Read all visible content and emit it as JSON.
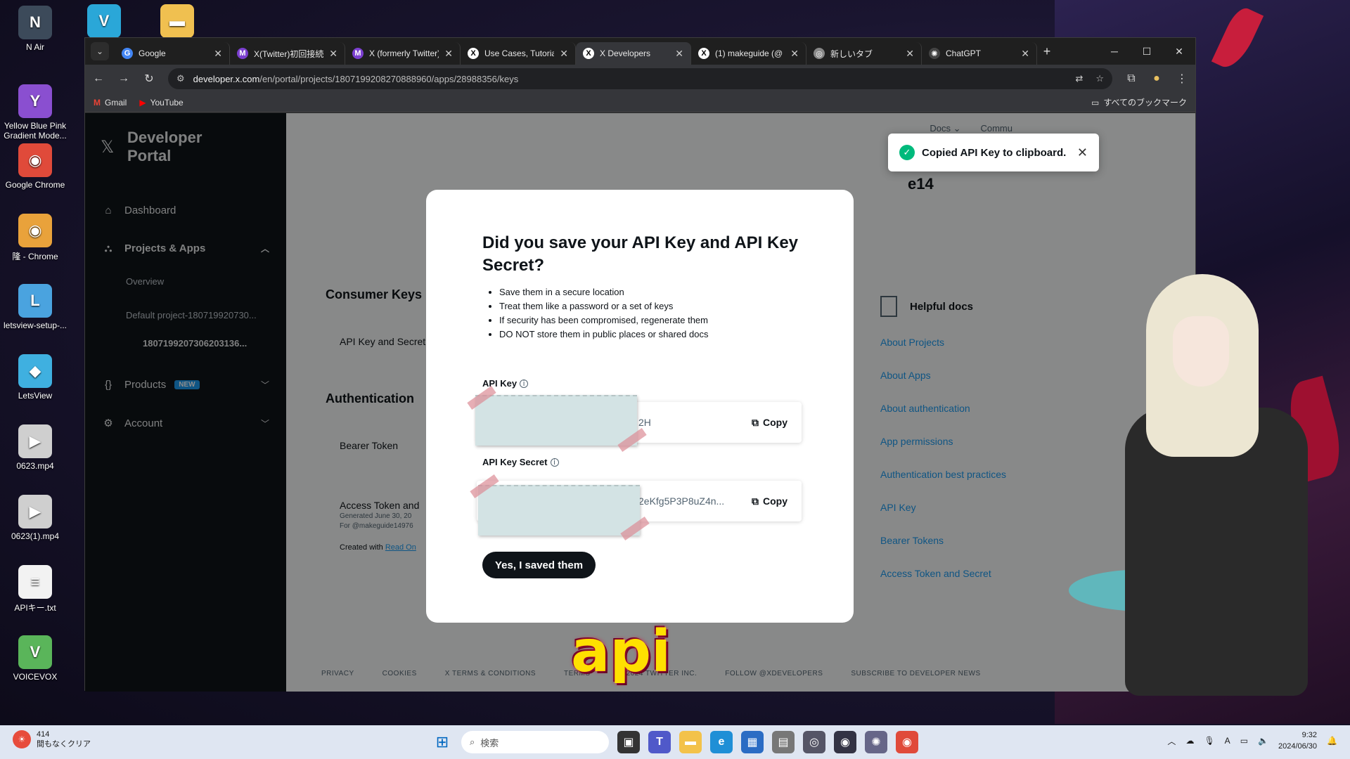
{
  "desktop": {
    "icons": [
      {
        "label": "N Air",
        "glyph": "N",
        "color": "#3c4a5a"
      },
      {
        "label": "Yellow Blue Pink Gradient Mode...",
        "glyph": "Y",
        "color": "#8a4fd0"
      },
      {
        "label": "Google Chrome",
        "glyph": "◉",
        "color": "#e04a3a"
      },
      {
        "label": "隆 - Chrome",
        "glyph": "◉",
        "color": "#e9a23b"
      },
      {
        "label": "letsview-setup-...",
        "glyph": "L",
        "color": "#4aa3df"
      },
      {
        "label": "LetsView",
        "glyph": "◆",
        "color": "#3fb0e0"
      },
      {
        "label": "0623.mp4",
        "glyph": "▶",
        "color": "#cfcfcf"
      },
      {
        "label": "0623(1).mp4",
        "glyph": "▶",
        "color": "#cfcfcf"
      },
      {
        "label": "APIキー.txt",
        "glyph": "≡",
        "color": "#f2f2f2"
      },
      {
        "label": "VOICEVOX",
        "glyph": "V",
        "color": "#5ab55a"
      }
    ],
    "top_icons": [
      {
        "label": "",
        "glyph": "V",
        "color": "#2aa7d8"
      },
      {
        "label": "",
        "glyph": "▬",
        "color": "#f0c050"
      }
    ]
  },
  "browser": {
    "tabs": [
      {
        "title": "Google",
        "favicon": "G",
        "fav_color": "#4285f4"
      },
      {
        "title": "X(Twitter)初回接続",
        "favicon": "M",
        "fav_color": "#7b3fd0"
      },
      {
        "title": "X (formerly Twitter)",
        "favicon": "M",
        "fav_color": "#7b3fd0"
      },
      {
        "title": "Use Cases, Tutorials",
        "favicon": "X",
        "fav_color": "#000000"
      },
      {
        "title": "X Developers",
        "favicon": "X",
        "fav_color": "#000000",
        "active": true
      },
      {
        "title": "(1) makeguide (@",
        "favicon": "X",
        "fav_color": "#000000"
      },
      {
        "title": "新しいタブ",
        "favicon": "◎",
        "fav_color": "#888888"
      },
      {
        "title": "ChatGPT",
        "favicon": "✺",
        "fav_color": "#444444"
      }
    ],
    "url_host": "developer.x.com",
    "url_path": "/en/portal/projects/1807199208270888960/apps/28988356/keys",
    "bookmarks": [
      {
        "label": "Gmail",
        "glyph": "M"
      },
      {
        "label": "YouTube",
        "glyph": "▶"
      }
    ],
    "all_bookmarks": "すべてのブックマーク"
  },
  "portal": {
    "title_line1": "Developer",
    "title_line2": "Portal",
    "nav": {
      "dashboard": "Dashboard",
      "projects_apps": "Projects & Apps",
      "overview": "Overview",
      "default_project": "Default project-180719920730...",
      "app_id": "1807199207306203136...",
      "products": "Products",
      "products_badge": "NEW",
      "account": "Account"
    },
    "topnav": [
      "Docs",
      "Commu"
    ],
    "app_title_suffix": "e14",
    "consumer_keys": "Consumer Keys",
    "api_key_and_secret": "API Key and Secret",
    "authentication": "Authentication",
    "bearer_token": "Bearer Token",
    "access_token": "Access Token and",
    "generated": "Generated June 30, 20",
    "for_user": "For @makeguide14976",
    "created_with": "Created with",
    "read_only": "Read On",
    "helpful_docs": "Helpful docs",
    "helpful_links": [
      "About Projects",
      "About Apps",
      "About authentication",
      "App permissions",
      "Authentication best practices",
      "API Key",
      "Bearer Tokens",
      "Access Token and Secret"
    ],
    "footer": [
      "PRIVACY",
      "COOKIES",
      "X TERMS & CONDITIONS",
      "TERMS",
      "© 2024 TWITTER INC.",
      "FOLLOW @XDEVELOPERS",
      "SUBSCRIBE TO DEVELOPER NEWS"
    ]
  },
  "toast": {
    "message": "Copied API Key to clipboard."
  },
  "modal": {
    "title": "Did you save your API Key and API Key Secret?",
    "bullets": [
      "Save them in a secure location",
      "Treat them like a password or a set of keys",
      "If security has been compromised, regenerate them",
      "DO NOT store them in public places or shared docs"
    ],
    "api_key_label": "API Key",
    "api_key_value": "2H",
    "api_key_secret_label": "API Key Secret",
    "api_key_secret_value": "2eKfg5P3P8uZ4n...",
    "copy_label": "Copy",
    "confirm_button": "Yes, I saved them"
  },
  "caption": "api",
  "taskbar": {
    "weather_count": "414",
    "weather_text": "間もなくクリア",
    "search_placeholder": "検索",
    "time": "9:32",
    "date": "2024/06/30"
  }
}
